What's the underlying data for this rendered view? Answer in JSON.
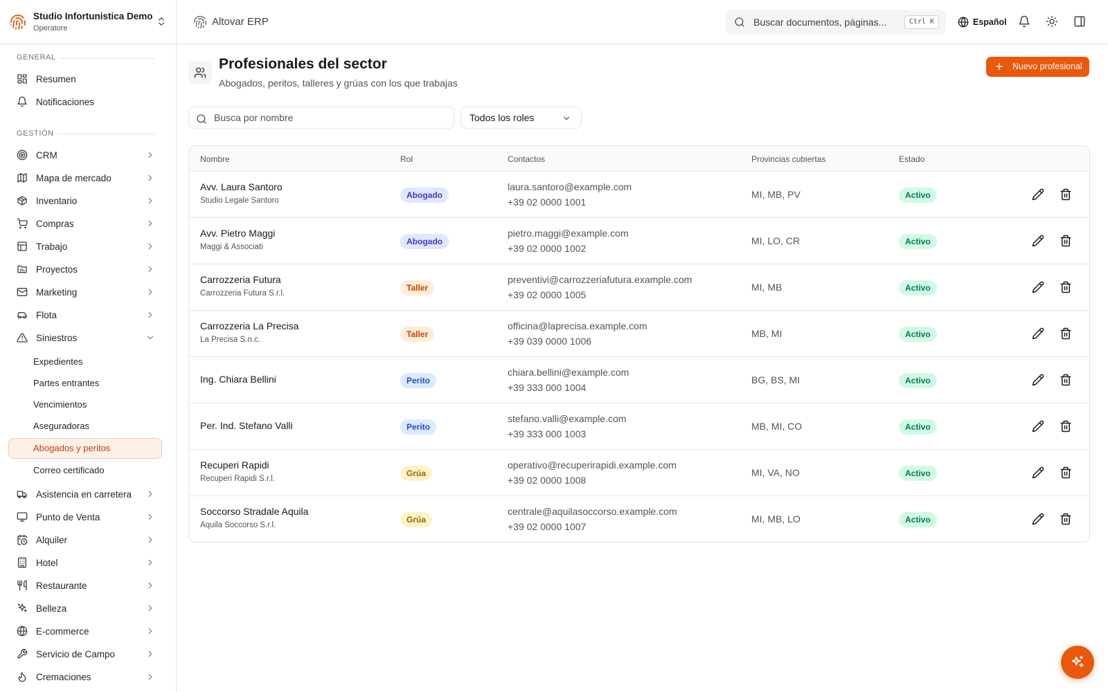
{
  "org": {
    "name": "Studio Infortunistica Demo",
    "role": "Operatore"
  },
  "sidebar": {
    "sections": [
      {
        "title": "GENERAL",
        "items": [
          {
            "label": "Resumen",
            "icon": "dashboard-icon"
          },
          {
            "label": "Notificaciones",
            "icon": "bell-icon"
          }
        ]
      },
      {
        "title": "GESTIÓN",
        "items": [
          {
            "label": "CRM",
            "icon": "target-icon"
          },
          {
            "label": "Mapa de mercado",
            "icon": "map-icon"
          },
          {
            "label": "Inventario",
            "icon": "package-icon"
          },
          {
            "label": "Compras",
            "icon": "cart-icon"
          },
          {
            "label": "Trabajo",
            "icon": "clipboard-icon"
          },
          {
            "label": "Proyectos",
            "icon": "chart-folder-icon"
          },
          {
            "label": "Marketing",
            "icon": "mail-icon"
          },
          {
            "label": "Flota",
            "icon": "car-icon"
          },
          {
            "label": "Siniestros",
            "icon": "warning-icon",
            "expanded": true,
            "children": [
              {
                "label": "Expedientes"
              },
              {
                "label": "Partes entrantes"
              },
              {
                "label": "Vencimientos"
              },
              {
                "label": "Aseguradoras"
              },
              {
                "label": "Abogados y peritos",
                "active": true
              },
              {
                "label": "Correo certificado"
              }
            ]
          },
          {
            "label": "Asistencia en carretera",
            "icon": "truck-icon"
          },
          {
            "label": "Punto de Venta",
            "icon": "monitor-icon"
          },
          {
            "label": "Alquiler",
            "icon": "calendar-clock-icon"
          },
          {
            "label": "Hotel",
            "icon": "building-icon"
          },
          {
            "label": "Restaurante",
            "icon": "utensils-icon"
          },
          {
            "label": "Belleza",
            "icon": "sparkles-icon"
          },
          {
            "label": "E-commerce",
            "icon": "globe-icon"
          },
          {
            "label": "Servicio de Campo",
            "icon": "wrench-icon"
          },
          {
            "label": "Cremaciones",
            "icon": "flame-icon"
          }
        ]
      }
    ]
  },
  "topbar": {
    "app_title": "Altovar ERP",
    "search_placeholder": "Buscar documentos, páginas...",
    "shortcut": "Ctrl K",
    "language": "Español"
  },
  "page": {
    "title": "Profesionales del sector",
    "subtitle": "Abogados, peritos, talleres y grúas con los que trabajas",
    "new_button": "Nuevo profesional",
    "search_placeholder": "Busca por nombre",
    "role_filter": "Todos los roles"
  },
  "table": {
    "headers": {
      "name": "Nombre",
      "role": "Rol",
      "contacts": "Contactos",
      "provinces": "Provincias cubiertas",
      "status": "Estado"
    },
    "rows": [
      {
        "name": "Avv. Laura Santoro",
        "company": "Studio Legale Santoro",
        "role": "Abogado",
        "role_kind": "abogado",
        "email": "laura.santoro@example.com",
        "phone": "+39 02 0000 1001",
        "provinces": "MI, MB, PV",
        "status": "Activo"
      },
      {
        "name": "Avv. Pietro Maggi",
        "company": "Maggi & Associati",
        "role": "Abogado",
        "role_kind": "abogado",
        "email": "pietro.maggi@example.com",
        "phone": "+39 02 0000 1002",
        "provinces": "MI, LO, CR",
        "status": "Activo"
      },
      {
        "name": "Carrozzeria Futura",
        "company": "Carrozzeria Futura S.r.l.",
        "role": "Taller",
        "role_kind": "taller",
        "email": "preventivi@carrozzeriafutura.example.com",
        "phone": "+39 02 0000 1005",
        "provinces": "MI, MB",
        "status": "Activo"
      },
      {
        "name": "Carrozzeria La Precisa",
        "company": "La Precisa S.n.c.",
        "role": "Taller",
        "role_kind": "taller",
        "email": "officina@laprecisa.example.com",
        "phone": "+39 039 0000 1006",
        "provinces": "MB, MI",
        "status": "Activo"
      },
      {
        "name": "Ing. Chiara Bellini",
        "company": "",
        "role": "Perito",
        "role_kind": "perito",
        "email": "chiara.bellini@example.com",
        "phone": "+39 333 000 1004",
        "provinces": "BG, BS, MI",
        "status": "Activo"
      },
      {
        "name": "Per. Ind. Stefano Valli",
        "company": "",
        "role": "Perito",
        "role_kind": "perito",
        "email": "stefano.valli@example.com",
        "phone": "+39 333 000 1003",
        "provinces": "MB, MI, CO",
        "status": "Activo"
      },
      {
        "name": "Recuperi Rapidi",
        "company": "Recuperi Rapidi S.r.l.",
        "role": "Grúa",
        "role_kind": "grua",
        "email": "operativo@recuperirapidi.example.com",
        "phone": "+39 02 0000 1008",
        "provinces": "MI, VA, NO",
        "status": "Activo"
      },
      {
        "name": "Soccorso Stradale Aquila",
        "company": "Aquila Soccorso S.r.l.",
        "role": "Grúa",
        "role_kind": "grua",
        "email": "centrale@aquilasoccorso.example.com",
        "phone": "+39 02 0000 1007",
        "provinces": "MI, MB, LO",
        "status": "Activo"
      }
    ]
  },
  "colors": {
    "accent": "#ea580c",
    "active_bg": "#fdf0e9",
    "status_green": "#047857"
  }
}
